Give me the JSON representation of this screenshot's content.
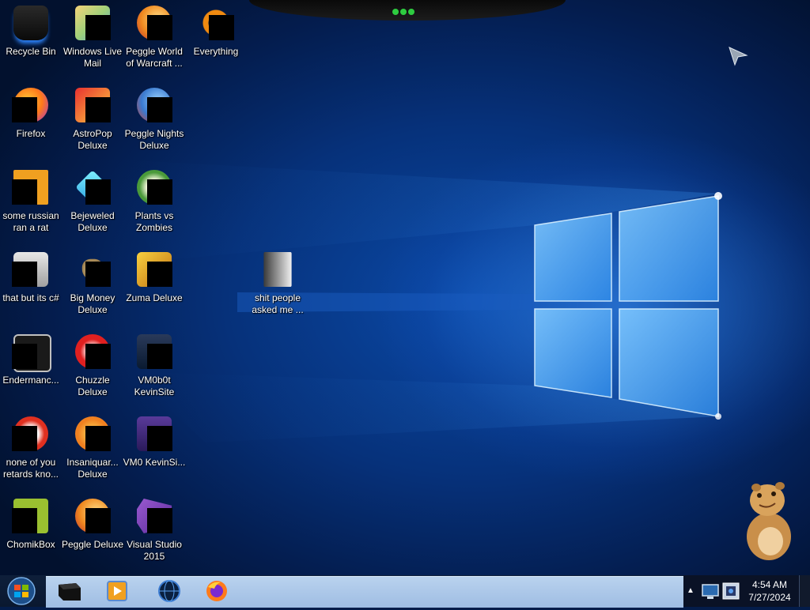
{
  "desktop": {
    "icons": [
      {
        "label": "Recycle Bin",
        "icon": "recycle-bin-icon"
      },
      {
        "label": "Windows Live Mail",
        "icon": "mail-icon"
      },
      {
        "label": "Peggle World of Warcraft ...",
        "icon": "peggle-icon"
      },
      {
        "label": "Everything",
        "icon": "search-icon"
      },
      {
        "label": "Firefox",
        "icon": "firefox-icon"
      },
      {
        "label": "AstroPop Deluxe",
        "icon": "game-icon"
      },
      {
        "label": "Peggle Nights Deluxe",
        "icon": "peggle-icon"
      },
      {
        "label": "some russian ran a rat",
        "icon": "app-icon"
      },
      {
        "label": "Bejeweled Deluxe",
        "icon": "gem-icon"
      },
      {
        "label": "Plants vs Zombies",
        "icon": "plant-icon"
      },
      {
        "label": "that but its c#",
        "icon": "app-icon"
      },
      {
        "label": "Big Money Deluxe",
        "icon": "money-bag-icon"
      },
      {
        "label": "Zuma Deluxe",
        "icon": "game-icon"
      },
      {
        "label": "shit people asked me ...",
        "icon": "folder-icon"
      },
      {
        "label": "Endermanc...",
        "icon": "app-icon"
      },
      {
        "label": "Chuzzle Deluxe",
        "icon": "game-icon"
      },
      {
        "label": "VM0b0t KevinSite",
        "icon": "vm-icon"
      },
      {
        "label": "none of you retards kno...",
        "icon": "app-icon"
      },
      {
        "label": "Insaniquar... Deluxe",
        "icon": "fish-icon"
      },
      {
        "label": "VM0 KevinSi...",
        "icon": "vm-icon"
      },
      {
        "label": "ChomikBox",
        "icon": "hamster-icon"
      },
      {
        "label": "Peggle Deluxe",
        "icon": "peggle-icon"
      },
      {
        "label": "Visual Studio 2015",
        "icon": "visual-studio-icon"
      }
    ]
  },
  "taskbar": {
    "start_label": "Start",
    "pinned": [
      "terminal-icon",
      "media-player-icon",
      "globe-icon",
      "firefox-icon"
    ]
  },
  "clock": {
    "time": "4:54 AM",
    "date": "7/27/2024"
  },
  "colors": {
    "wallpaper": "#06317a",
    "taskbar_mid": "#b9d2ee",
    "tray": "#0a1226"
  }
}
